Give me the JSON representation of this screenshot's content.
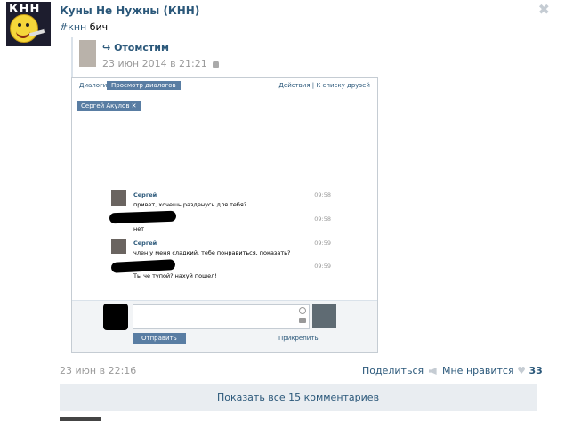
{
  "post": {
    "group_name": "Куны Не Нужны (КНН)",
    "avatar_text": "КНН",
    "hashtag": "#кнн",
    "text": "бич",
    "close_glyph": "✖",
    "repost": {
      "arrow": "↪",
      "author": "Отомстим",
      "date": "23 июн 2014 в 21:21"
    },
    "footer": {
      "date": "23 июн в 22:16",
      "share_label": "Поделиться",
      "like_label": "Мне нравится",
      "like_count": "33",
      "show_comments": "Показать все 15 комментариев"
    }
  },
  "embedded": {
    "tabs": [
      "Диалоги",
      "Просмотр диалогов"
    ],
    "tab_right": "Действия | К списку друзей",
    "chip": "Сергей Акулов",
    "messages": [
      {
        "author": "Сергей",
        "text": "привет, хочешь разденусь для тебя?",
        "time": "09:58"
      },
      {
        "author": "",
        "text": "нет",
        "time": "09:58"
      },
      {
        "author": "Сергей",
        "text": "член у меня сладкий, тебе понравиться, показать?",
        "time": "09:59"
      },
      {
        "author": "",
        "text": "Ты че тупой? нахуй пошел!",
        "time": "09:59"
      }
    ],
    "send_label": "Отправить",
    "attach_label": "Прикрепить"
  }
}
